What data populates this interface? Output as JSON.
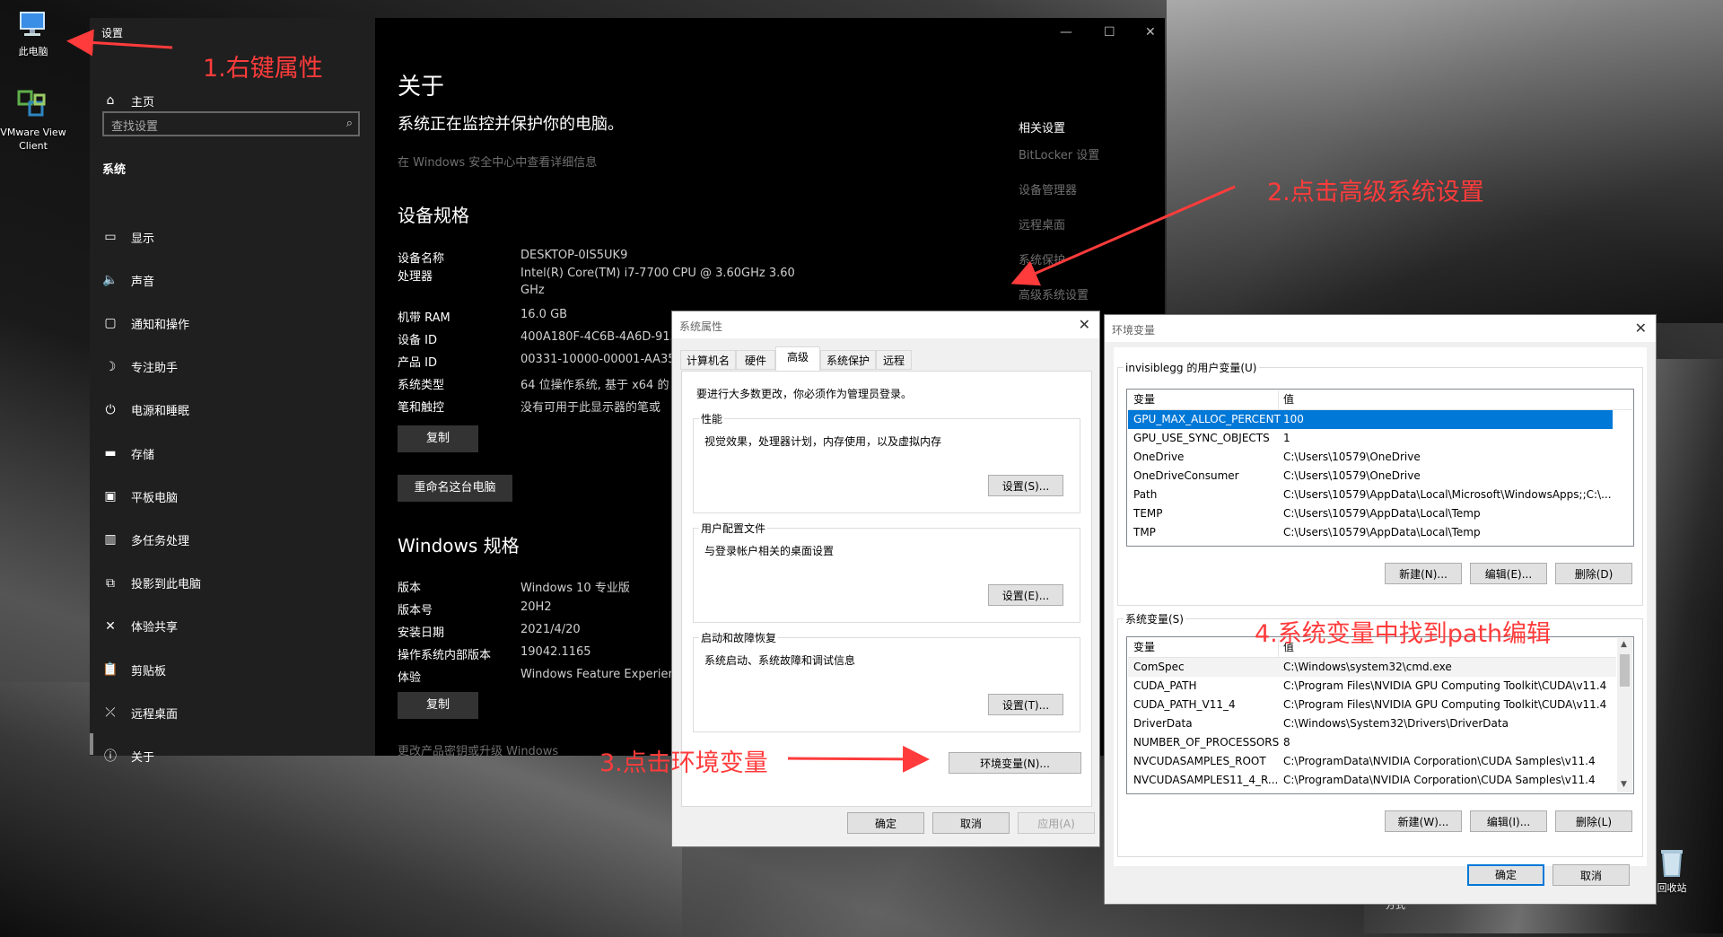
{
  "desktop": {
    "icons": [
      {
        "label": "此电脑"
      },
      {
        "label": "VMware View Client"
      }
    ],
    "recycle_label": "回收站",
    "partial_label": "方式"
  },
  "settings": {
    "title": "设置",
    "home": "主页",
    "search_placeholder": "查找设置",
    "section": "系统",
    "nav": [
      {
        "icon": "display-icon",
        "label": "显示"
      },
      {
        "icon": "sound-icon",
        "label": "声音"
      },
      {
        "icon": "notification-icon",
        "label": "通知和操作"
      },
      {
        "icon": "focus-assist-icon",
        "label": "专注助手"
      },
      {
        "icon": "power-icon",
        "label": "电源和睡眠"
      },
      {
        "icon": "storage-icon",
        "label": "存储"
      },
      {
        "icon": "tablet-icon",
        "label": "平板电脑"
      },
      {
        "icon": "multitask-icon",
        "label": "多任务处理"
      },
      {
        "icon": "project-icon",
        "label": "投影到此电脑"
      },
      {
        "icon": "share-icon",
        "label": "体验共享"
      },
      {
        "icon": "clipboard-icon",
        "label": "剪贴板"
      },
      {
        "icon": "remote-desktop-icon",
        "label": "远程桌面"
      },
      {
        "icon": "info-icon",
        "label": "关于"
      }
    ],
    "main": {
      "heading": "关于",
      "protect_text": "系统正在监控并保护你的电脑。",
      "protect_link": "在 Windows 安全中心中查看详细信息",
      "device_spec_heading": "设备规格",
      "device_specs": [
        {
          "label": "设备名称",
          "value": "DESKTOP-0IS5UK9"
        },
        {
          "label": "处理器",
          "value": "Intel(R) Core(TM) i7-7700 CPU @ 3.60GHz   3.60",
          "value2": "GHz"
        },
        {
          "label": "机带 RAM",
          "value": "16.0 GB"
        },
        {
          "label": "设备 ID",
          "value": "400A180F-4C6B-4A6D-913F"
        },
        {
          "label": "产品 ID",
          "value": "00331-10000-00001-AA353"
        },
        {
          "label": "系统类型",
          "value": "64 位操作系统, 基于 x64 的"
        },
        {
          "label": "笔和触控",
          "value": "没有可用于此显示器的笔或"
        }
      ],
      "copy_button": "复制",
      "rename_button": "重命名这台电脑",
      "win_spec_heading": "Windows 规格",
      "win_specs": [
        {
          "label": "版本",
          "value": "Windows 10 专业版"
        },
        {
          "label": "版本号",
          "value": "20H2"
        },
        {
          "label": "安装日期",
          "value": "2021/4/20"
        },
        {
          "label": "操作系统内部版本",
          "value": "19042.1165"
        },
        {
          "label": "体验",
          "value": "Windows Feature Experien"
        }
      ],
      "copy_button2": "复制",
      "footer_link": "更改产品密钥或升级 Windows",
      "related_heading": "相关设置",
      "related_links": [
        "BitLocker 设置",
        "设备管理器",
        "远程桌面",
        "系统保护",
        "高级系统设置"
      ]
    }
  },
  "sysprops": {
    "title": "系统属性",
    "tabs": [
      "计算机名",
      "硬件",
      "高级",
      "系统保护",
      "远程"
    ],
    "admin_note": "要进行大多数更改，你必须作为管理员登录。",
    "perf_title": "性能",
    "perf_desc": "视觉效果，处理器计划，内存使用，以及虚拟内存",
    "perf_button": "设置(S)...",
    "profile_title": "用户配置文件",
    "profile_desc": "与登录帐户相关的桌面设置",
    "profile_button": "设置(E)...",
    "startup_title": "启动和故障恢复",
    "startup_desc": "系统启动、系统故障和调试信息",
    "startup_button": "设置(T)...",
    "env_button": "环境变量(N)...",
    "ok": "确定",
    "cancel": "取消",
    "apply": "应用(A)"
  },
  "envvars": {
    "title": "环境变量",
    "user_group": "invisiblegg 的用户变量(U)",
    "col_var": "变量",
    "col_val": "值",
    "user_vars": [
      {
        "name": "GPU_MAX_ALLOC_PERCENT",
        "value": "100"
      },
      {
        "name": "GPU_USE_SYNC_OBJECTS",
        "value": "1"
      },
      {
        "name": "OneDrive",
        "value": "C:\\Users\\10579\\OneDrive"
      },
      {
        "name": "OneDriveConsumer",
        "value": "C:\\Users\\10579\\OneDrive"
      },
      {
        "name": "Path",
        "value": "C:\\Users\\10579\\AppData\\Local\\Microsoft\\WindowsApps;;C:\\..."
      },
      {
        "name": "TEMP",
        "value": "C:\\Users\\10579\\AppData\\Local\\Temp"
      },
      {
        "name": "TMP",
        "value": "C:\\Users\\10579\\AppData\\Local\\Temp"
      }
    ],
    "user_buttons": [
      "新建(N)...",
      "编辑(E)...",
      "删除(D)"
    ],
    "sys_group": "系统变量(S)",
    "sys_vars": [
      {
        "name": "ComSpec",
        "value": "C:\\Windows\\system32\\cmd.exe"
      },
      {
        "name": "CUDA_PATH",
        "value": "C:\\Program Files\\NVIDIA GPU Computing Toolkit\\CUDA\\v11.4"
      },
      {
        "name": "CUDA_PATH_V11_4",
        "value": "C:\\Program Files\\NVIDIA GPU Computing Toolkit\\CUDA\\v11.4"
      },
      {
        "name": "DriverData",
        "value": "C:\\Windows\\System32\\Drivers\\DriverData"
      },
      {
        "name": "NUMBER_OF_PROCESSORS",
        "value": "8"
      },
      {
        "name": "NVCUDASAMPLES_ROOT",
        "value": "C:\\ProgramData\\NVIDIA Corporation\\CUDA Samples\\v11.4"
      },
      {
        "name": "NVCUDASAMPLES11_4_R...",
        "value": "C:\\ProgramData\\NVIDIA Corporation\\CUDA Samples\\v11.4"
      }
    ],
    "sys_buttons": [
      "新建(W)...",
      "编辑(I)...",
      "删除(L)"
    ],
    "ok": "确定",
    "cancel": "取消"
  },
  "annotations": {
    "step1": "1.右键属性",
    "step2": "2.点击高级系统设置",
    "step3": "3.点击环境变量",
    "step4": "4.系统变量中找到path编辑",
    "color": "#ff3b3b"
  }
}
